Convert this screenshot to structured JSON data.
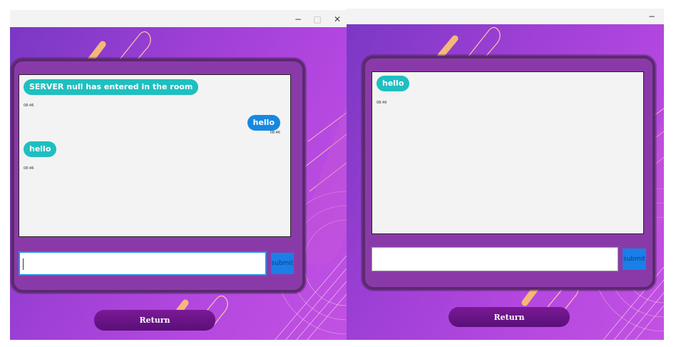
{
  "window_left": {
    "controls": {
      "minimize": "−",
      "maximize": "□",
      "close": "✕"
    },
    "messages": [
      {
        "text": "SERVER null has entered in the room",
        "time": "08:46",
        "side": "in"
      },
      {
        "text": "hello",
        "time": "08:46",
        "side": "out"
      },
      {
        "text": "hello",
        "time": "08:46",
        "side": "in"
      }
    ],
    "input_value": "",
    "submit_label": "submit",
    "return_label": "Return"
  },
  "window_right": {
    "controls": {
      "minimize": "−"
    },
    "messages": [
      {
        "text": "hello",
        "time": "08:46",
        "side": "in"
      }
    ],
    "input_value": "",
    "submit_label": "submit",
    "return_label": "Return"
  },
  "colors": {
    "background_gradient": [
      "#7a38c4",
      "#c252e3"
    ],
    "panel": "#8a3aa8",
    "incoming_bubble": "#1fbfc0",
    "outgoing_bubble": "#1788e0",
    "submit": "#1a7fe8",
    "return_button": "#6a148a"
  }
}
